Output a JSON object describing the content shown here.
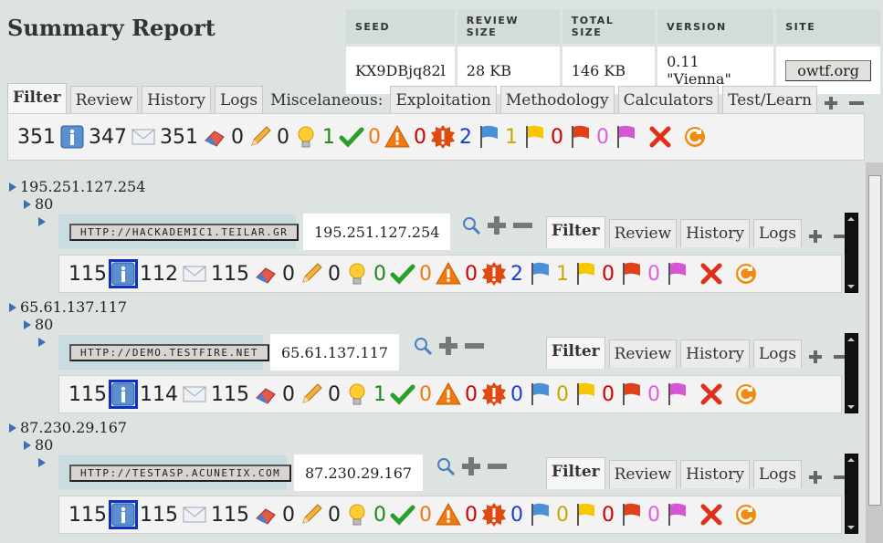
{
  "title": "Summary Report",
  "info": {
    "headers": [
      "SEED",
      "REVIEW SIZE",
      "TOTAL SIZE",
      "VERSION",
      "SITE"
    ],
    "seed": "KX9DBjq82l",
    "review_size": "28 KB",
    "total_size": "146 KB",
    "version": "0.11 \"Vienna\"",
    "site": "owtf.org"
  },
  "top_tabs": {
    "filter": "Filter",
    "review": "Review",
    "history": "History",
    "logs": "Logs",
    "misc": "Miscelaneous:",
    "exploitation": "Exploitation",
    "methodology": "Methodology",
    "calculators": "Calculators",
    "testlearn": "Test/Learn"
  },
  "top_counts": [
    "351",
    "347",
    "351",
    "0",
    "0",
    "1",
    "0",
    "0",
    "2",
    "1",
    "0",
    "0"
  ],
  "targets": [
    {
      "ip": "195.251.127.254",
      "port": "80",
      "url": "HTTP://HACKADEMIC1.TEILAR.GR",
      "counts": [
        "115",
        "112",
        "115",
        "0",
        "0",
        "0",
        "0",
        "0",
        "2",
        "1",
        "0",
        "0"
      ]
    },
    {
      "ip": "65.61.137.117",
      "port": "80",
      "url": "HTTP://DEMO.TESTFIRE.NET",
      "counts": [
        "115",
        "114",
        "115",
        "0",
        "0",
        "1",
        "0",
        "0",
        "0",
        "0",
        "0",
        "0"
      ]
    },
    {
      "ip": "87.230.29.167",
      "port": "80",
      "url": "HTTP://TESTASP.ACUNETIX.COM",
      "counts": [
        "115",
        "115",
        "115",
        "0",
        "0",
        "0",
        "0",
        "0",
        "0",
        "0",
        "0",
        "0"
      ]
    }
  ],
  "target_tabs": {
    "filter": "Filter",
    "review": "Review",
    "history": "History",
    "logs": "Logs"
  },
  "colors": {
    "green": "#1a8a1a",
    "orange": "#f07a10",
    "red": "#d00000",
    "blue": "#1a3fcc",
    "yellow": "#c8a800",
    "violet": "#e05ce0"
  },
  "icons": [
    "info-icon",
    "mail-icon",
    "eraser-icon",
    "pencil-icon",
    "bulb-icon",
    "check-icon",
    "warning-icon",
    "alert-icon",
    "blue-flag-icon",
    "yellow-flag-icon",
    "red-flag-icon",
    "violet-flag-icon",
    "delete-icon",
    "refresh-icon"
  ]
}
